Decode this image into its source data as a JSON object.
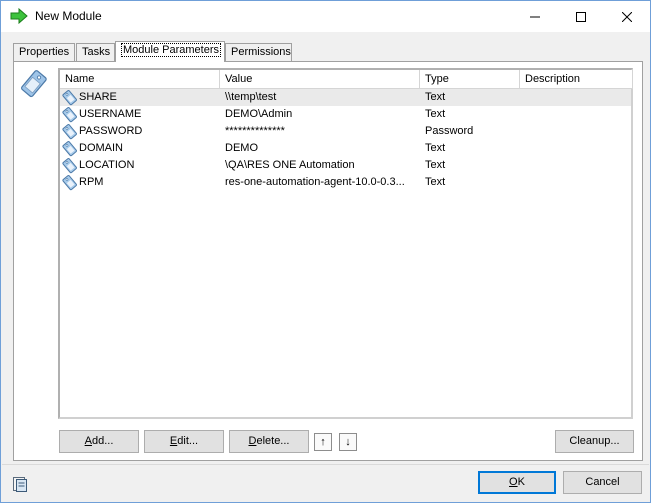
{
  "window": {
    "title": "New Module"
  },
  "tabs": [
    {
      "label": "Properties"
    },
    {
      "label": "Tasks"
    },
    {
      "label": "Module Parameters"
    },
    {
      "label": "Permissions"
    }
  ],
  "list": {
    "columns": [
      "Name",
      "Value",
      "Type",
      "Description"
    ],
    "rows": [
      {
        "name": "SHARE",
        "value": "\\\\temp\\test",
        "type": "Text",
        "description": ""
      },
      {
        "name": "USERNAME",
        "value": "DEMO\\Admin",
        "type": "Text",
        "description": ""
      },
      {
        "name": "PASSWORD",
        "value": "**************",
        "type": "Password",
        "description": ""
      },
      {
        "name": "DOMAIN",
        "value": "DEMO",
        "type": "Text",
        "description": ""
      },
      {
        "name": "LOCATION",
        "value": "\\QA\\RES ONE Automation",
        "type": "Text",
        "description": ""
      },
      {
        "name": "RPM",
        "value": "res-one-automation-agent-10.0-0.3...",
        "type": "Text",
        "description": ""
      }
    ]
  },
  "buttons": {
    "add": {
      "key": "A",
      "rest": "dd..."
    },
    "edit": {
      "key": "E",
      "rest": "dit..."
    },
    "delete": {
      "key": "D",
      "rest": "elete..."
    },
    "move_up": "↑",
    "move_down": "↓",
    "cleanup": "Cleanup...",
    "ok": {
      "key": "O",
      "rest": "K"
    },
    "cancel": "Cancel"
  },
  "colors": {
    "accent": "#0078d7",
    "title_icon": "#2fb52f"
  }
}
